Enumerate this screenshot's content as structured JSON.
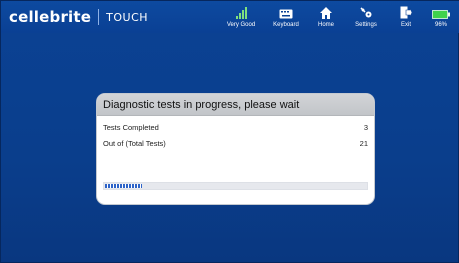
{
  "header": {
    "brand": "cellebrite",
    "product": "TOUCH",
    "tools": [
      {
        "label": "Very Good",
        "icon": "signal-icon"
      },
      {
        "label": "Keyboard",
        "icon": "keyboard-icon"
      },
      {
        "label": "Home",
        "icon": "home-icon"
      },
      {
        "label": "Settings",
        "icon": "settings-icon"
      },
      {
        "label": "Exit",
        "icon": "exit-icon"
      },
      {
        "label": "96%",
        "icon": "battery-icon"
      }
    ]
  },
  "dialog": {
    "title": "Diagnostic tests in progress, please wait",
    "rows": [
      {
        "label": "Tests Completed",
        "value": "3"
      },
      {
        "label": "Out of (Total Tests)",
        "value": "21"
      }
    ],
    "progress_fraction": 0.14
  },
  "colors": {
    "background": "#0a3f8e",
    "accent": "#2d63c8",
    "battery": "#3fd24c"
  }
}
